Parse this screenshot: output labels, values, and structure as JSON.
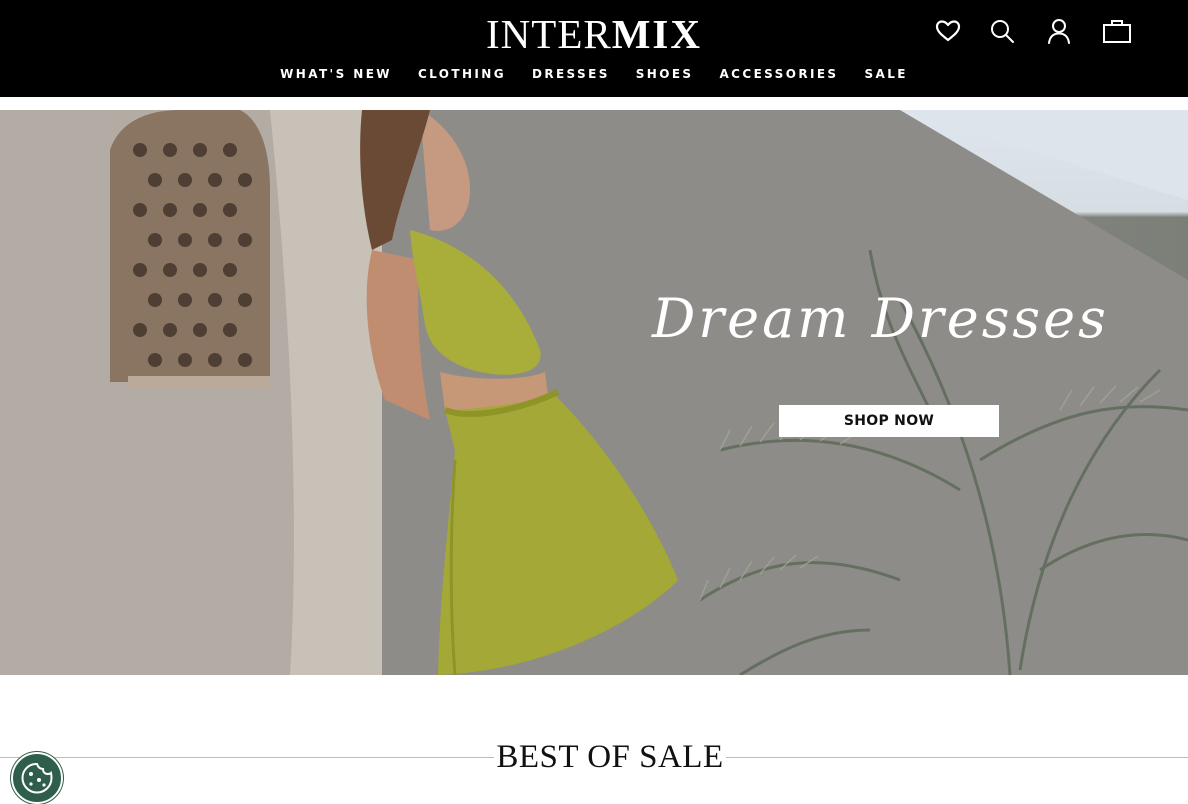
{
  "header": {
    "logo": {
      "part1": "INTER",
      "part2": "MIX"
    },
    "nav": [
      {
        "label": "WHAT'S NEW"
      },
      {
        "label": "CLOTHING"
      },
      {
        "label": "DRESSES"
      },
      {
        "label": "SHOES"
      },
      {
        "label": "ACCESSORIES"
      },
      {
        "label": "SALE"
      }
    ],
    "icons": [
      "heart-icon",
      "search-icon",
      "account-icon",
      "bag-icon"
    ]
  },
  "hero": {
    "headline": "Dream Dresses",
    "cta_label": "SHOP NOW"
  },
  "section": {
    "title": "BEST OF SALE"
  },
  "cookie": {
    "icon": "cookie-icon"
  },
  "colors": {
    "header_bg": "#000000",
    "header_text": "#ffffff",
    "dress": "#a9ad3a",
    "cookie_bg": "#2f5e4b"
  }
}
